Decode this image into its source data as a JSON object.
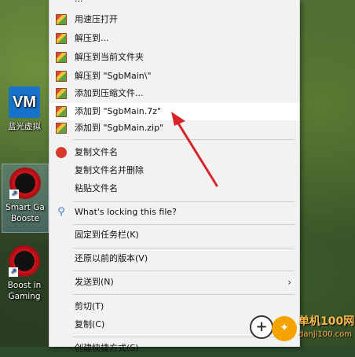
{
  "desktop": {
    "icons": [
      {
        "id": "vm",
        "label": "蓝光虚拟",
        "glyph": "VM"
      },
      {
        "id": "smart-game-booster",
        "label1": "Smart Ga",
        "label2": "Booste"
      },
      {
        "id": "boost-gaming",
        "label1": "Boost in",
        "label2": "Gaming"
      }
    ]
  },
  "context_menu": {
    "top_partial": "...",
    "items": [
      {
        "label": "用速压打开"
      },
      {
        "label": "解压到..."
      },
      {
        "label": "解压到当前文件夹"
      },
      {
        "label": "解压到 \"SgbMain\\\""
      },
      {
        "label": "添加到压缩文件..."
      },
      {
        "label": "添加到 \"SgbMain.7z\""
      },
      {
        "label": "添加到 \"SgbMain.zip\""
      },
      {
        "label": "复制文件名"
      },
      {
        "label": "复制文件名并删除"
      },
      {
        "label": "粘贴文件名"
      },
      {
        "label": "What's locking this file?"
      },
      {
        "label": "固定到任务栏(K)"
      },
      {
        "label": "还原以前的版本(V)"
      },
      {
        "label": "发送到(N)"
      },
      {
        "label": "剪切(T)"
      },
      {
        "label": "复制(C)"
      },
      {
        "label": "创建快捷方式(S)"
      }
    ]
  },
  "watermark": {
    "brand_line": "单机100网",
    "url_line": "danji100.com"
  },
  "colors": {
    "menu_bg": "#f2f2f2",
    "highlight": "#ffffff",
    "arrow": "#d8232a"
  }
}
